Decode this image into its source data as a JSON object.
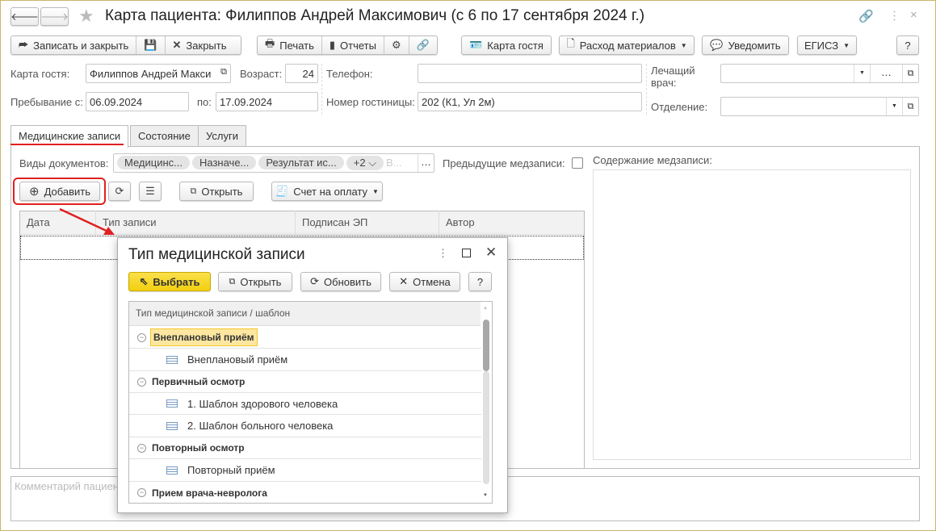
{
  "window": {
    "title": "Карта пациента: Филиппов Андрей Максимович (с 6 по 17 сентября 2024 г.)"
  },
  "toolbar": {
    "save_close": "Записать и закрыть",
    "close": "Закрыть",
    "print": "Печать",
    "reports": "Отчеты",
    "guest_card": "Карта гостя",
    "materials": "Расход материалов",
    "notify": "Уведомить",
    "egisz": "ЕГИСЗ",
    "help": "?"
  },
  "form": {
    "guest_card_label": "Карта гостя:",
    "guest_card_value": "Филиппов Андрей Макси",
    "age_label": "Возраст:",
    "age_value": "24",
    "phone_label": "Телефон:",
    "phone_value": "",
    "doctor_label": "Лечащий врач:",
    "stay_from_label": "Пребывание с:",
    "stay_from": "06.09.2024",
    "stay_to_label": "по:",
    "stay_to": "17.09.2024",
    "room_label": "Номер гостиницы:",
    "room_value": "202 (К1, Ул 2м)",
    "department_label": "Отделение:"
  },
  "tabs": [
    {
      "label": "Медицинские записи",
      "active": true
    },
    {
      "label": "Состояние"
    },
    {
      "label": "Услуги"
    }
  ],
  "records": {
    "doc_types_label": "Виды документов:",
    "chips": [
      "Медицинс...",
      "Назначе...",
      "Результат ис..."
    ],
    "more": "+2",
    "placeholder": "В...",
    "prev_label": "Предыдущие медзаписи:",
    "add": "Добавить",
    "open": "Открыть",
    "invoice": "Счет на оплату",
    "columns": [
      "Дата",
      "Тип записи",
      "Подписан ЭП",
      "Автор"
    ],
    "content_label": "Содержание медзаписи:",
    "comment_placeholder": "Комментарий пациента"
  },
  "dialog": {
    "title": "Тип медицинской записи",
    "select": "Выбрать",
    "open": "Открыть",
    "refresh": "Обновить",
    "cancel": "Отмена",
    "help": "?",
    "column": "Тип медицинской записи / шаблон",
    "rows": [
      {
        "text": "Внеплановый приём",
        "group": true,
        "selected": true
      },
      {
        "text": "Внеплановый приём"
      },
      {
        "text": "Первичный осмотр",
        "group": true
      },
      {
        "text": "1. Шаблон здорового человека"
      },
      {
        "text": "2. Шаблон больного человека"
      },
      {
        "text": "Повторный осмотр",
        "group": true
      },
      {
        "text": "Повторный приём"
      },
      {
        "text": "Прием врача-невролога",
        "group": true
      }
    ]
  },
  "colors": {
    "accent_red": "#e02020",
    "select_yellow": "#f5d519"
  }
}
